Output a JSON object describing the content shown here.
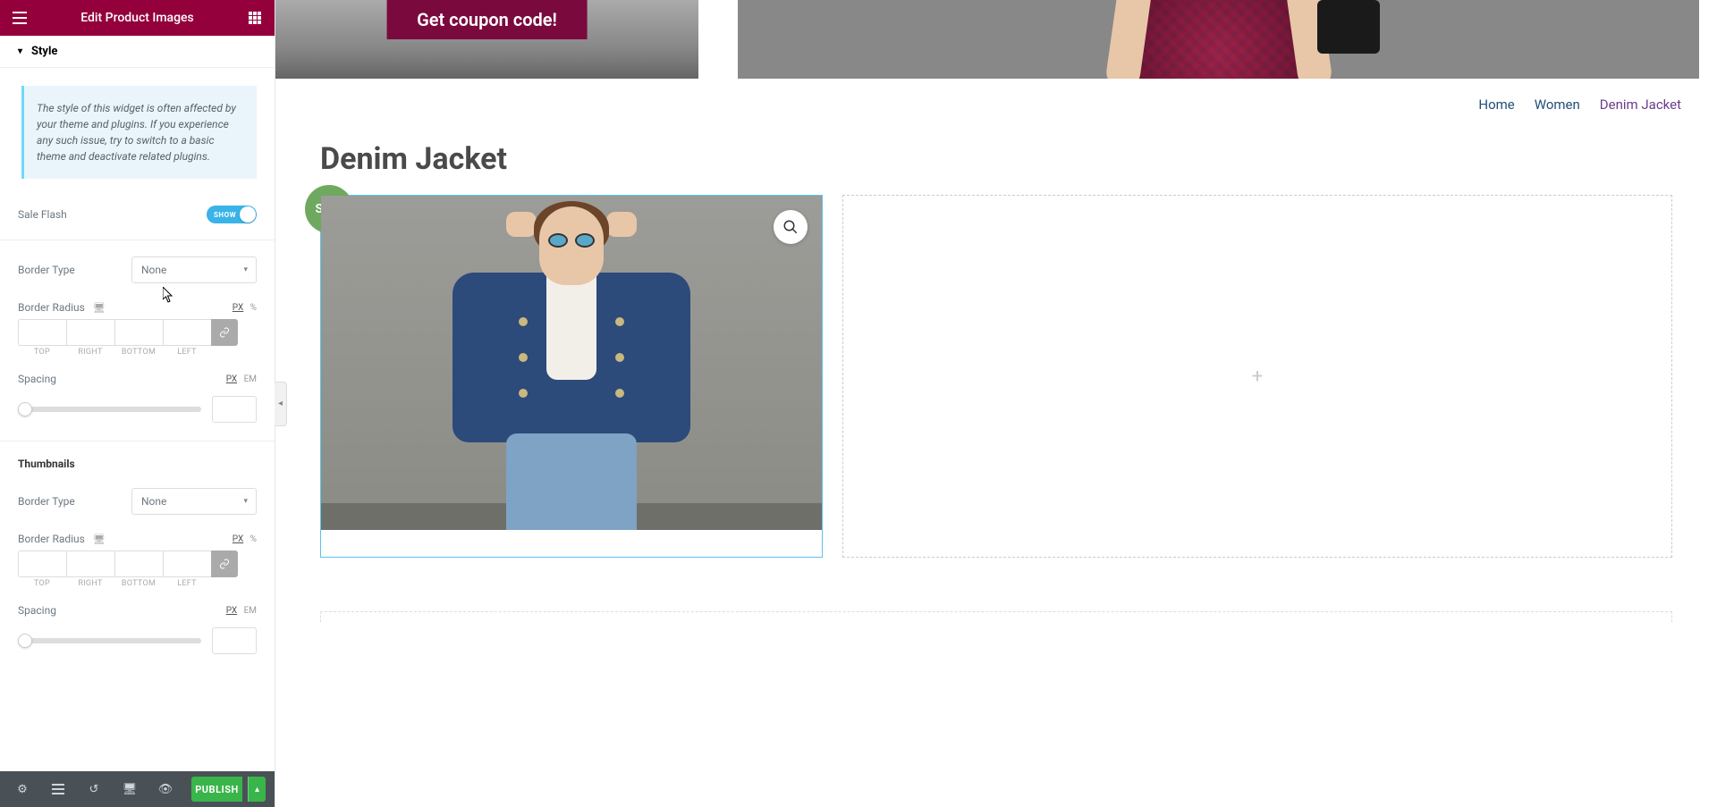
{
  "header": {
    "title": "Edit Product Images"
  },
  "accordion": {
    "style": "Style"
  },
  "info_box": "The style of this widget is often affected by your theme and plugins. If you experience any such issue, try to switch to a basic theme and deactivate related plugins.",
  "sale_flash": {
    "label": "Sale Flash",
    "toggle": "SHOW"
  },
  "main_image": {
    "border_type_label": "Border Type",
    "border_type_value": "None",
    "border_radius_label": "Border Radius",
    "units_px": "PX",
    "units_pct": "%",
    "dim_top": "TOP",
    "dim_right": "RIGHT",
    "dim_bottom": "BOTTOM",
    "dim_left": "LEFT",
    "spacing_label": "Spacing",
    "units_em": "EM"
  },
  "thumbnails": {
    "section_title": "Thumbnails",
    "border_type_label": "Border Type",
    "border_type_value": "None",
    "border_radius_label": "Border Radius",
    "units_px": "PX",
    "units_pct": "%",
    "dim_top": "TOP",
    "dim_right": "RIGHT",
    "dim_bottom": "BOTTOM",
    "dim_left": "LEFT",
    "spacing_label": "Spacing",
    "units_em": "EM"
  },
  "footer": {
    "publish": "PUBLISH"
  },
  "canvas": {
    "coupon_btn": "Get coupon code!",
    "breadcrumbs": {
      "home": "Home",
      "women": "Women",
      "current": "Denim Jacket"
    },
    "page_title": "Denim Jacket",
    "sale_badge": "Sale!"
  }
}
